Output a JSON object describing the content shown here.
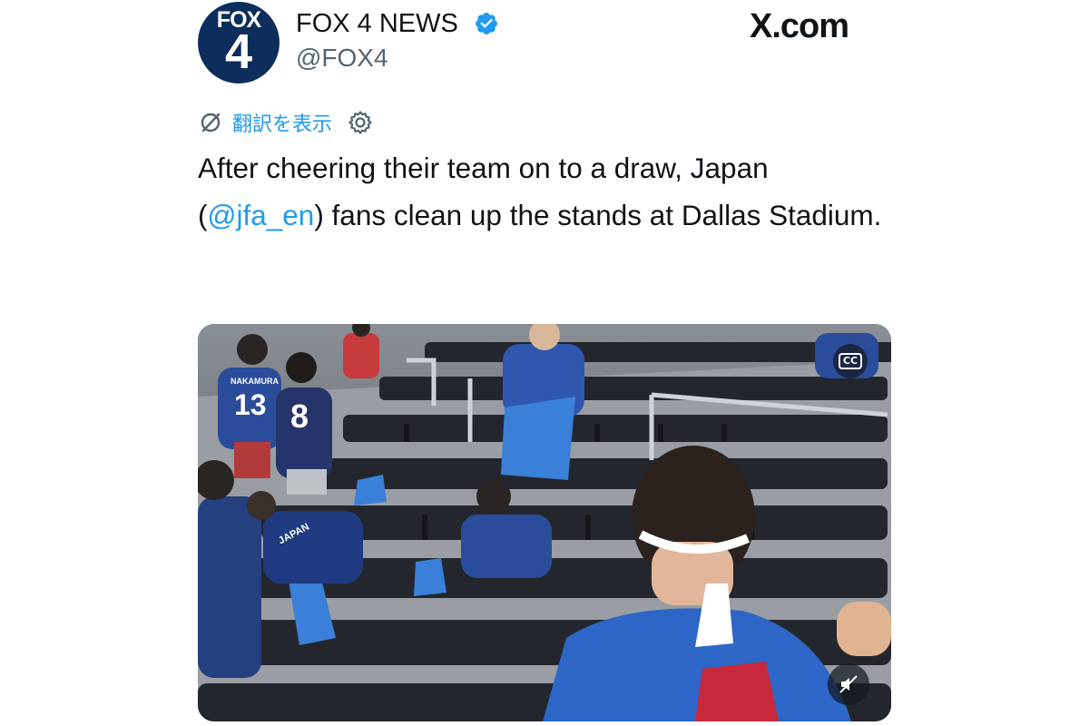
{
  "tweet": {
    "author": {
      "display_name": "FOX 4 NEWS",
      "handle": "@FOX4",
      "verified": true,
      "avatar_text": "FOX",
      "avatar_number": "4"
    },
    "site_brand": "X.com",
    "translate": {
      "label": "翻訳を表示",
      "icon": "globe-slash-icon",
      "settings_icon": "gear-icon"
    },
    "text_before": "After cheering their team on to a draw, Japan (",
    "mention": "@jfa_en",
    "text_after": ") fans clean up the stands at Dallas Stadium.",
    "media": {
      "type": "video",
      "captions_button": "CC",
      "mute_icon": "speaker-muted-icon",
      "jersey_texts": [
        "NAKAMURA",
        "13",
        "8",
        "JAPAN"
      ]
    }
  },
  "colors": {
    "accent": "#1d9bf0",
    "verified_badge": "#1d9bf0",
    "avatar_bg": "#0d2e5c",
    "text": "#0f1419",
    "secondary_text": "#536471",
    "jersey_blue": "#2b4c9a"
  }
}
